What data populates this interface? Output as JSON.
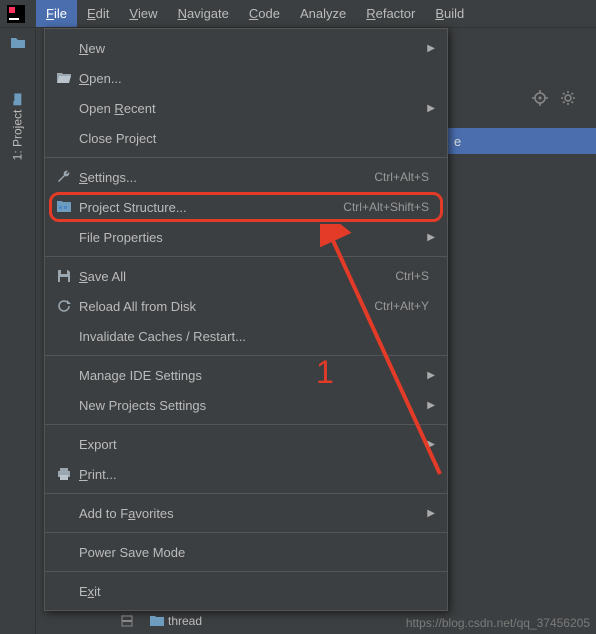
{
  "menubar": {
    "items": [
      {
        "label": "File",
        "mn": "F"
      },
      {
        "label": "Edit",
        "mn": "E"
      },
      {
        "label": "View",
        "mn": "V"
      },
      {
        "label": "Navigate",
        "mn": "N"
      },
      {
        "label": "Code",
        "mn": "C"
      },
      {
        "label": "Analyze",
        "mn": null
      },
      {
        "label": "Refactor",
        "mn": "R"
      },
      {
        "label": "Build",
        "mn": "B"
      }
    ]
  },
  "sidebar": {
    "tab_label": "1: Project"
  },
  "dropdown": {
    "items": [
      {
        "label": "New",
        "mn": "N",
        "shortcut": "",
        "submenu": true,
        "icon": null
      },
      {
        "label": "Open...",
        "mn": "O",
        "shortcut": "",
        "submenu": false,
        "icon": "folder-open"
      },
      {
        "label": "Open Recent",
        "mn": "R",
        "shortcut": "",
        "submenu": true,
        "icon": null
      },
      {
        "label": "Close Project",
        "mn": null,
        "shortcut": "",
        "submenu": false,
        "icon": null
      },
      {
        "sep": true
      },
      {
        "label": "Settings...",
        "mn": "S",
        "shortcut": "Ctrl+Alt+S",
        "submenu": false,
        "icon": "wrench"
      },
      {
        "label": "Project Structure...",
        "mn": null,
        "shortcut": "Ctrl+Alt+Shift+S",
        "submenu": false,
        "icon": "project-structure",
        "highlighted": true
      },
      {
        "label": "File Properties",
        "mn": null,
        "shortcut": "",
        "submenu": true,
        "icon": null
      },
      {
        "sep": true
      },
      {
        "label": "Save All",
        "mn": "S",
        "shortcut": "Ctrl+S",
        "submenu": false,
        "icon": "save"
      },
      {
        "label": "Reload All from Disk",
        "mn": null,
        "shortcut": "Ctrl+Alt+Y",
        "submenu": false,
        "icon": "reload"
      },
      {
        "label": "Invalidate Caches / Restart...",
        "mn": null,
        "shortcut": "",
        "submenu": false,
        "icon": null
      },
      {
        "sep": true
      },
      {
        "label": "Manage IDE Settings",
        "mn": null,
        "shortcut": "",
        "submenu": true,
        "icon": null
      },
      {
        "label": "New Projects Settings",
        "mn": null,
        "shortcut": "",
        "submenu": true,
        "icon": null
      },
      {
        "sep": true
      },
      {
        "label": "Export",
        "mn": null,
        "shortcut": "",
        "submenu": true,
        "icon": null
      },
      {
        "label": "Print...",
        "mn": "P",
        "shortcut": "",
        "submenu": false,
        "icon": "print"
      },
      {
        "sep": true
      },
      {
        "label": "Add to Favorites",
        "mn": "a",
        "shortcut": "",
        "submenu": true,
        "icon": null
      },
      {
        "sep": true
      },
      {
        "label": "Power Save Mode",
        "mn": null,
        "shortcut": "",
        "submenu": false,
        "icon": null
      },
      {
        "sep": true
      },
      {
        "label": "Exit",
        "mn": "x",
        "shortcut": "",
        "submenu": false,
        "icon": null
      }
    ]
  },
  "open_file_strip": {
    "label_fragment": "e"
  },
  "bottom_tabs": {
    "thread": "thread"
  },
  "annotation": {
    "number": "1"
  },
  "watermark": "https://blog.csdn.net/qq_37456205"
}
